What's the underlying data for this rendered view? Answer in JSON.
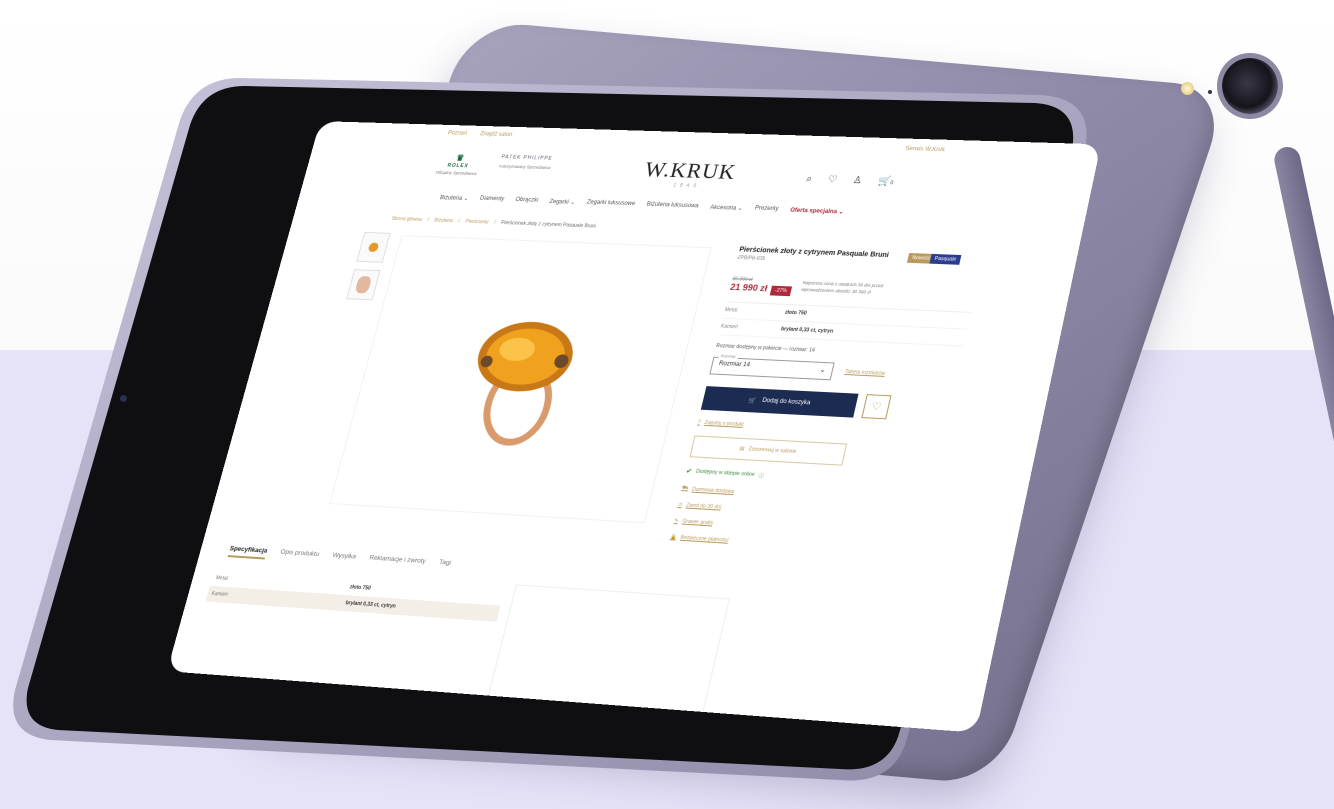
{
  "colors": {
    "accent_gold": "#b89a5e",
    "navy": "#1c2b52",
    "sale_red": "#b0293a",
    "rolex_green": "#1b6b3a",
    "lavender_bg": "#e6e3f8",
    "tablet_purple": "#8f8aa8"
  },
  "topbar": {
    "left_links": [
      "Poznań",
      "Znajdź salon"
    ],
    "right_link": "Serwis W.Kruk"
  },
  "brands": {
    "rolex": {
      "name": "ROLEX",
      "sub": "Oficjalny Sprzedawca"
    },
    "patek": {
      "name": "PATEK PHILIPPE",
      "sub": "Autoryzowany Sprzedawca"
    }
  },
  "logo": {
    "main": "W.KRUK",
    "sub": "1840"
  },
  "header_icons": [
    "search-icon",
    "heart-icon",
    "user-icon",
    "cart-icon"
  ],
  "cart_count": "0",
  "nav": {
    "items": [
      "Biżuteria ⌄",
      "Diamenty",
      "Obrączki",
      "Zegarki ⌄",
      "Zegarki luksusowe",
      "Biżuteria luksusowa",
      "Akcesoria ⌄",
      "Prezenty"
    ],
    "promo": "Oferta specjalna ⌄"
  },
  "breadcrumb": [
    "Strona główna",
    "Biżuteria",
    "Pierścionki",
    "Pierścionek złoty z cytrynem Pasquale Bruni"
  ],
  "product": {
    "title": "Pierścionek złoty z cytrynem Pasquale Bruni",
    "sku": "ZPB/PB-635",
    "badge_new": "Nowość",
    "badge_brand": "Pasquale",
    "old_price": "30 390 zł",
    "price": "21 990 zł",
    "discount": "-27%",
    "lowest_price_note": "Najniższa cena z ostatnich 30 dni przed wprowadzeniem obniżki: 30 390 zł",
    "attributes": [
      {
        "k": "Metal",
        "v": "złoto 750"
      },
      {
        "k": "Kamień",
        "v": "brylant 0,33 ct, cytryn"
      }
    ],
    "size_info": "Rozmiar dostępny w pakiecie — rozmiar: 14",
    "size_label": "Rozmiar",
    "size_value": "Rozmiar 14",
    "size_guide": "Tabela rozmiarów",
    "add_to_cart": "Dodaj do koszyka",
    "ask_link": "Zapytaj o produkt",
    "reserve_label": "Zarezerwuj w salonie",
    "availability": "Dostępny w sklepie online",
    "extra_links": [
      "Darmowa dostawa",
      "Zwrot do 30 dni",
      "Grawer gratis",
      "Bezpieczne płatności"
    ]
  },
  "tabs": [
    "Specyfikacja",
    "Opis produktu",
    "Wysyłka",
    "Reklamacje i zwroty",
    "Tagi"
  ],
  "spec_rows": [
    {
      "k": "Metal",
      "v": "złoto 750"
    },
    {
      "k": "Kamień",
      "v": "brylant 0,33 ct, cytryn"
    }
  ]
}
